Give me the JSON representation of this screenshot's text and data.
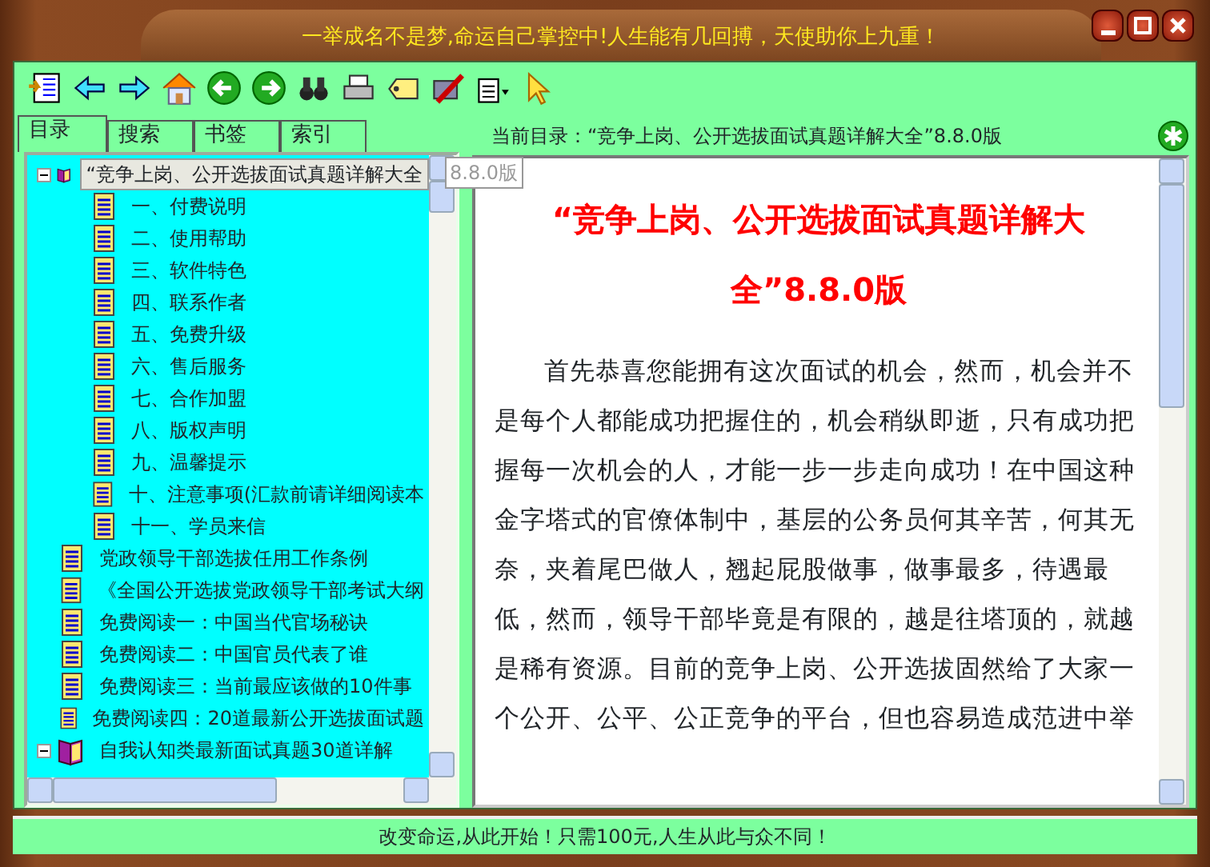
{
  "window": {
    "title": "一举成名不是梦,命运自己掌控中!人生能有几回搏，天使助你上九重！"
  },
  "tabs": [
    {
      "label": "目录",
      "selected": true
    },
    {
      "label": "搜索",
      "selected": false
    },
    {
      "label": "书签",
      "selected": false
    },
    {
      "label": "索引",
      "selected": false
    }
  ],
  "tree": [
    {
      "label": "“竞争上岗、公开选拔面试真题详解大全",
      "kind": "book",
      "expanded": true,
      "selected": true,
      "children": [
        {
          "label": "一、付费说明",
          "kind": "page",
          "selected": false
        },
        {
          "label": "二、使用帮助",
          "kind": "page",
          "selected": false
        },
        {
          "label": "三、软件特色",
          "kind": "page",
          "selected": false
        },
        {
          "label": "四、联系作者",
          "kind": "page",
          "selected": false
        },
        {
          "label": "五、免费升级",
          "kind": "page",
          "selected": false
        },
        {
          "label": "六、售后服务",
          "kind": "page",
          "selected": false
        },
        {
          "label": "七、合作加盟",
          "kind": "page",
          "selected": false
        },
        {
          "label": "八、版权声明",
          "kind": "page",
          "selected": false
        },
        {
          "label": "九、温馨提示",
          "kind": "page",
          "selected": false
        },
        {
          "label": "十、注意事项(汇款前请详细阅读本",
          "kind": "page",
          "selected": false
        },
        {
          "label": "十一、学员来信",
          "kind": "page",
          "selected": false
        }
      ]
    },
    {
      "label": "党政领导干部选拔任用工作条例",
      "kind": "page",
      "selected": false
    },
    {
      "label": "《全国公开选拔党政领导干部考试大纲",
      "kind": "page",
      "selected": false
    },
    {
      "label": "免费阅读一：中国当代官场秘诀",
      "kind": "page",
      "selected": false
    },
    {
      "label": "免费阅读二：中国官员代表了谁",
      "kind": "page",
      "selected": false
    },
    {
      "label": "免费阅读三：当前最应该做的10件事",
      "kind": "page",
      "selected": false
    },
    {
      "label": "免费阅读四：20道最新公开选拔面试题",
      "kind": "page",
      "selected": false
    },
    {
      "label": "自我认知类最新面试真题30道详解",
      "kind": "book",
      "expanded": true,
      "selected": false
    }
  ],
  "tooltip": "8.8.0版",
  "content": {
    "header": "当前目录：“竞争上岗、公开选拔面试真题详解大全”8.8.0版",
    "heading": "“竞争上岗、公开选拔面试真题详解大全”8.8.0版",
    "paragraph": "首先恭喜您能拥有这次面试的机会，然而，机会并不是每个人都能成功把握住的，机会稍纵即逝，只有成功把握每一次机会的人，才能一步一步走向成功！在中国这种金字塔式的官僚体制中，基层的公务员何其辛苦，何其无奈，夹着尾巴做人，翘起屁股做事，做事最多，待遇最低，然而，领导干部毕竟是有限的，越是往塔顶的，就越是稀有资源。目前的竞争上岗、公开选拔固然给了大家一个公开、公平、公正竞争的平台，但也容易造成范进中举"
  },
  "status_bar": "改变命运,从此开始！只需100元,人生从此与众不同！"
}
